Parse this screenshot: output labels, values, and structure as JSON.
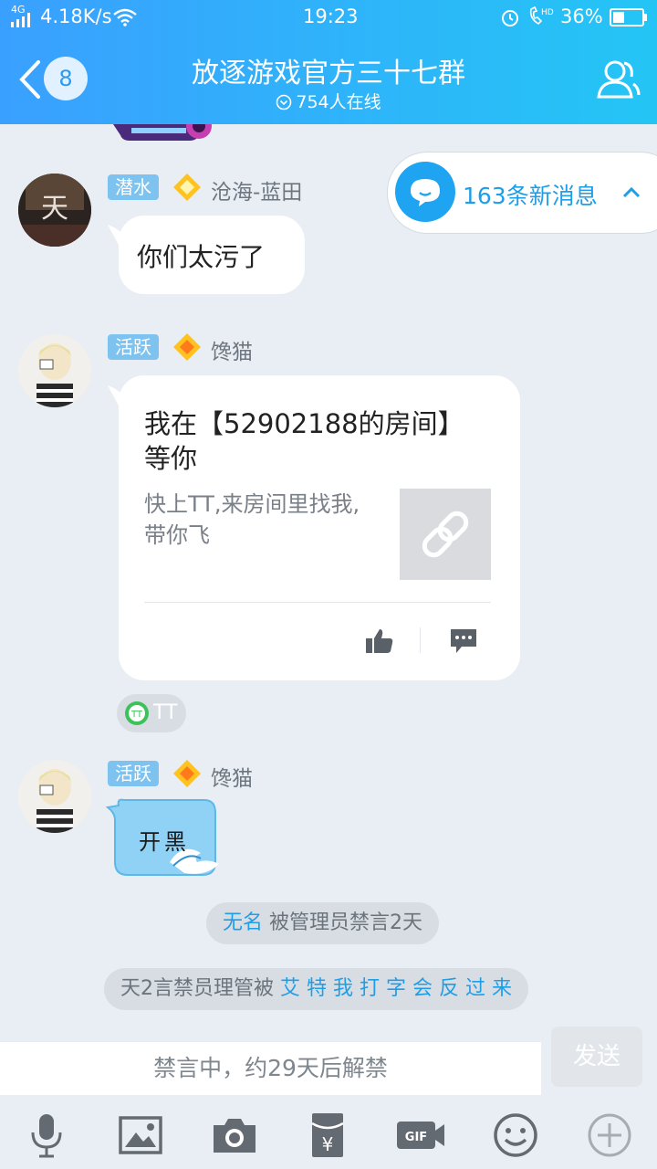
{
  "status_bar": {
    "signal": "4G",
    "network_speed": "4.18K/s",
    "time": "19:23",
    "battery": "36%"
  },
  "header": {
    "back_count": "8",
    "title": "放逐游戏官方三十七群",
    "online": "754人在线"
  },
  "new_messages": "163条新消息",
  "messages": [
    {
      "tag": "潜水",
      "nick": "沧海-蓝田",
      "text": "你们太污了"
    },
    {
      "tag": "活跃",
      "nick": "馋猫",
      "card_title": "我在【52902188的房间】等你",
      "card_desc": "快上TT,来房间里找我,带你飞",
      "source": "TT"
    },
    {
      "tag": "活跃",
      "nick": "馋猫",
      "sticker_text": "开黑"
    }
  ],
  "system": [
    {
      "name": "无名",
      "text": " 被管理员禁言2天"
    },
    {
      "prefix": "天2言禁员理管被 ",
      "highlight": "艾 特 我 打 字 会 反 过 来"
    }
  ],
  "input": {
    "placeholder": "禁言中，约29天后解禁",
    "send_label": "发送"
  },
  "toolbar": [
    "mic-icon",
    "image-icon",
    "camera-icon",
    "red-packet-icon",
    "gif-icon",
    "emoji-icon",
    "plus-icon"
  ],
  "colors": {
    "header_start": "#3aa0ff",
    "header_end": "#24c5f5",
    "accent": "#1f9ee8",
    "tag_bg": "#7ec3ef"
  }
}
